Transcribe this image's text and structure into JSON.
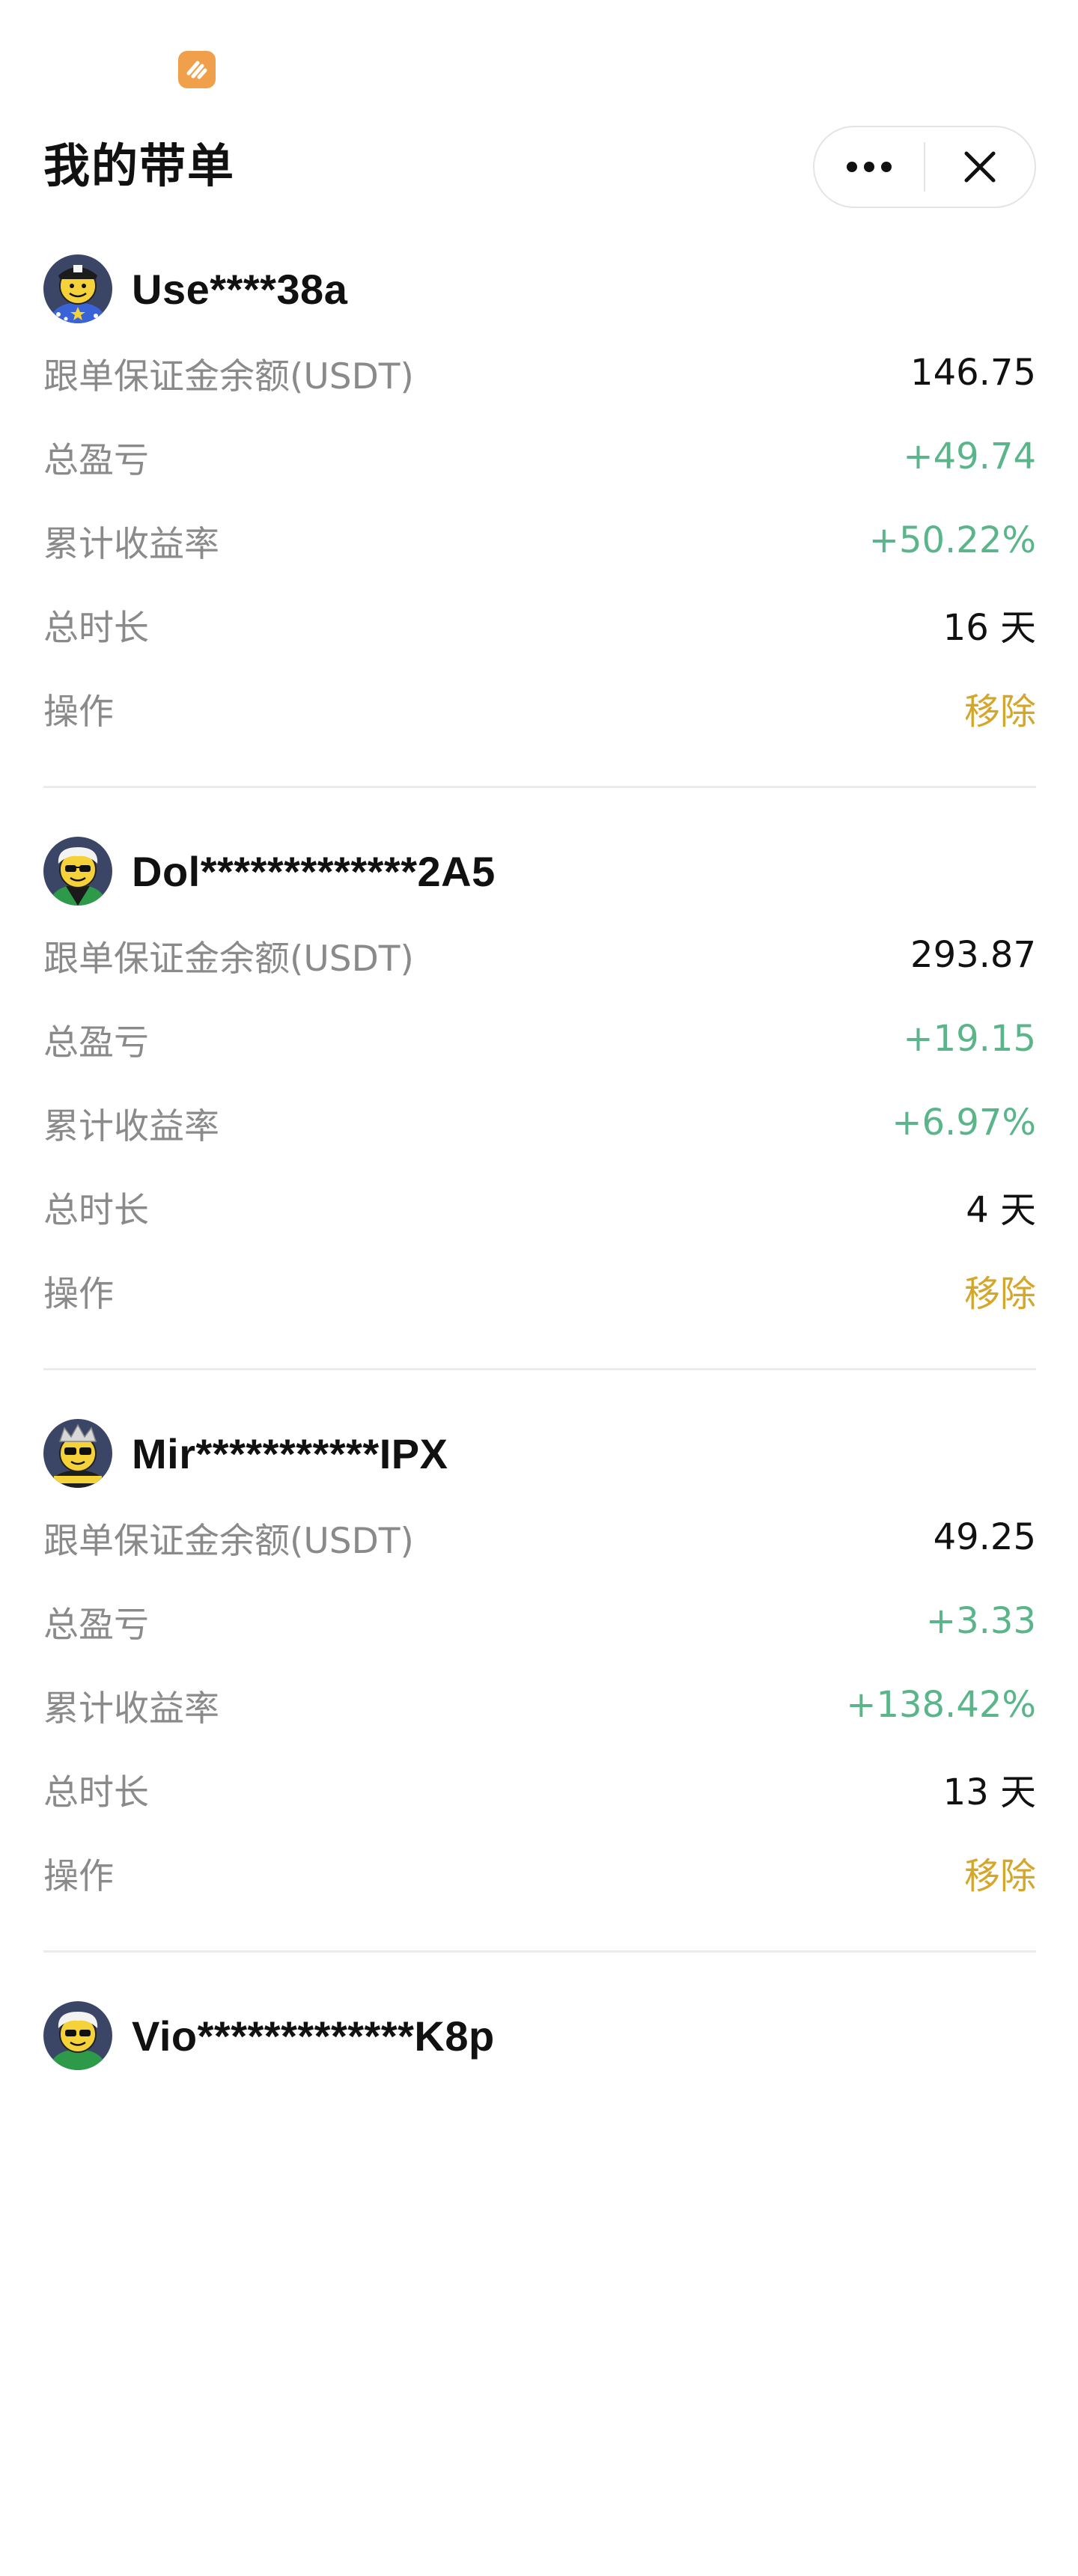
{
  "colors": {
    "positive": "#5bb58a",
    "action": "#d4a62a",
    "label": "#8a8a8a",
    "app_logo": "#f0a04b"
  },
  "header": {
    "title": "我的带单",
    "more_icon": "more-dots-icon",
    "close_icon": "close-icon"
  },
  "labels": {
    "margin_balance": "跟单保证金余额(USDT)",
    "total_pnl": "总盈亏",
    "cumulative_return": "累计收益率",
    "total_duration": "总时长",
    "operation": "操作"
  },
  "cards": [
    {
      "username": "Use****38a",
      "margin_balance": "146.75",
      "total_pnl": "+49.74",
      "cumulative_return": "+50.22%",
      "total_duration": "16 天",
      "action": "移除"
    },
    {
      "username": "Dol*************2A5",
      "margin_balance": "293.87",
      "total_pnl": "+19.15",
      "cumulative_return": "+6.97%",
      "total_duration": "4 天",
      "action": "移除"
    },
    {
      "username": "Mir***********IPX",
      "margin_balance": "49.25",
      "total_pnl": "+3.33",
      "cumulative_return": "+138.42%",
      "total_duration": "13 天",
      "action": "移除"
    },
    {
      "username": "Vio*************K8p"
    }
  ]
}
